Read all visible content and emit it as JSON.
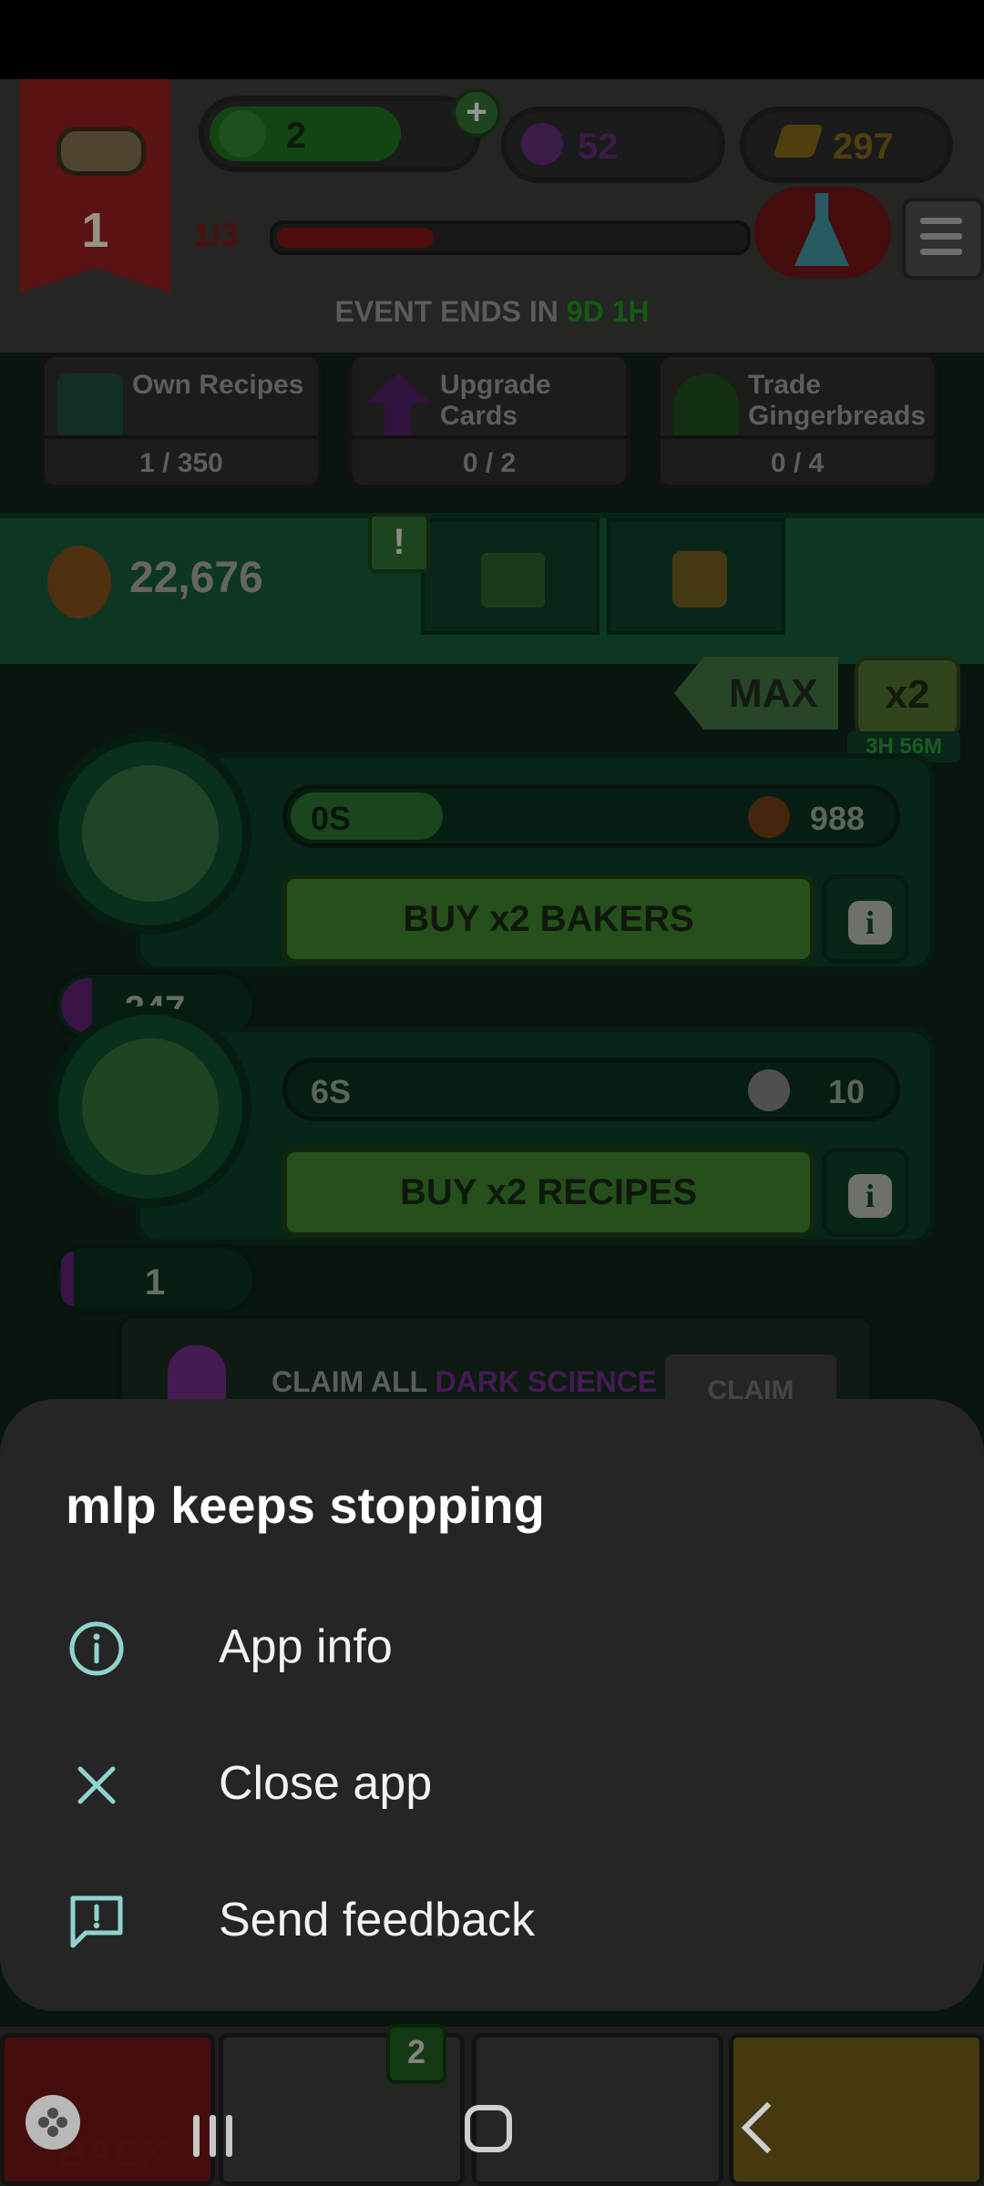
{
  "top_bar": {
    "level": "1",
    "hats": "2",
    "potions": "52",
    "gold": "297",
    "level_progress": "1/3",
    "level_progress_fraction": 0.33
  },
  "event": {
    "prefix": "EVENT ENDS IN ",
    "time": "9D 1H"
  },
  "tasks": [
    {
      "name": "Own Recipes",
      "count": "1 / 350"
    },
    {
      "name": "Upgrade Cards",
      "count": "0 / 2"
    },
    {
      "name": "Trade Gingerbreads",
      "count": "0 / 4"
    }
  ],
  "currency": {
    "gingerbread": "22,676",
    "alert": "!"
  },
  "multiplier": {
    "max_label": "MAX",
    "x2_label": "x2",
    "time_left": "3H 56M"
  },
  "rows": [
    {
      "time": "0S",
      "cost": "988",
      "button": "BUY x2 BAKERS",
      "level": "247",
      "progress": 0.25
    },
    {
      "time": "6S",
      "cost": "10",
      "button": "BUY x2 RECIPES",
      "level": "1",
      "progress": 0.0
    }
  ],
  "claim": {
    "prefix": "CLAIM ALL ",
    "highlight": "DARK SCIENCE",
    "button": "CLAIM"
  },
  "bottom_nav": {
    "back": "BACK",
    "badge": "2"
  },
  "dialog": {
    "title": "mlp keeps stopping",
    "items": [
      {
        "label": "App info",
        "icon": "info-icon"
      },
      {
        "label": "Close app",
        "icon": "close-icon"
      },
      {
        "label": "Send feedback",
        "icon": "feedback-icon"
      }
    ],
    "accent": "#8fd3cf"
  }
}
